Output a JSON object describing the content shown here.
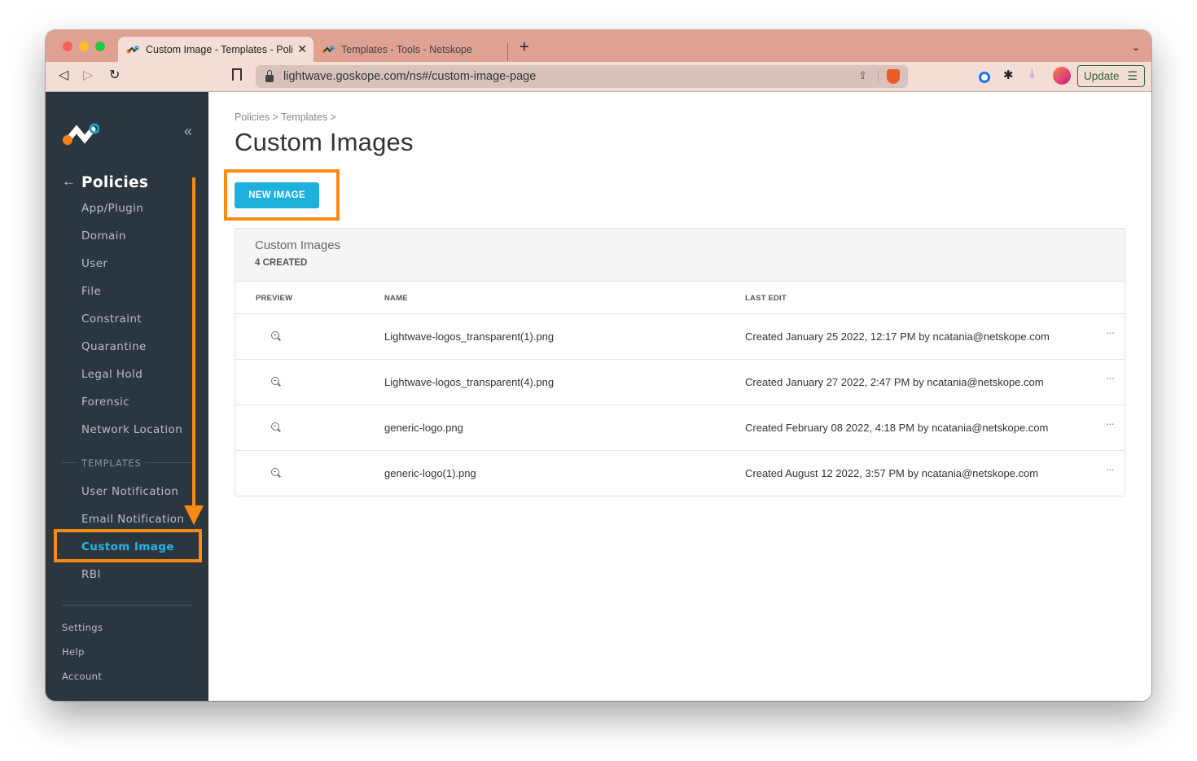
{
  "browser": {
    "tabs": [
      {
        "title": "Custom Image - Templates - Policies",
        "active": true
      },
      {
        "title": "Templates - Tools - Netskope",
        "active": false
      }
    ],
    "new_tab": "+",
    "url": "lightwave.goskope.com/ns#/custom-image-page",
    "update_label": "Update",
    "icons": {
      "back": "◁",
      "forward": "▷",
      "reload": "↻",
      "share": "⇪",
      "puzzle": "✱",
      "download": "⤓",
      "menu": "☰",
      "close": "✕",
      "chevron_down": "⌄"
    }
  },
  "sidebar": {
    "collapse_icon": "«",
    "back_icon": "←",
    "section_title": "Policies",
    "policy_items": [
      {
        "label": "App/Plugin"
      },
      {
        "label": "Domain"
      },
      {
        "label": "User"
      },
      {
        "label": "File"
      },
      {
        "label": "Constraint"
      },
      {
        "label": "Quarantine"
      },
      {
        "label": "Legal Hold"
      },
      {
        "label": "Forensic"
      },
      {
        "label": "Network Location"
      }
    ],
    "templates_label": "TEMPLATES",
    "template_items": [
      {
        "label": "User Notification",
        "active": false
      },
      {
        "label": "Email Notification",
        "active": false
      },
      {
        "label": "Custom Image",
        "active": true
      },
      {
        "label": "RBI",
        "active": false
      }
    ],
    "bottom_items": [
      {
        "label": "Settings"
      },
      {
        "label": "Help"
      },
      {
        "label": "Account"
      }
    ]
  },
  "main": {
    "breadcrumb": "Policies > Templates >",
    "title": "Custom Images",
    "new_button": "NEW IMAGE",
    "card": {
      "title": "Custom Images",
      "count": "4 CREATED",
      "columns": [
        "PREVIEW",
        "NAME",
        "LAST EDIT"
      ],
      "row_menu": "···",
      "rows": [
        {
          "name": "Lightwave-logos_transparent(1).png",
          "last_edit": "Created January 25 2022, 12:17 PM by ncatania@netskope.com"
        },
        {
          "name": "Lightwave-logos_transparent(4).png",
          "last_edit": "Created January 27 2022, 2:47 PM by ncatania@netskope.com"
        },
        {
          "name": "generic-logo.png",
          "last_edit": "Created February 08 2022, 4:18 PM by ncatania@netskope.com"
        },
        {
          "name": "generic-logo(1).png",
          "last_edit": "Created August 12 2022, 3:57 PM by ncatania@netskope.com"
        }
      ]
    }
  },
  "colors": {
    "accent": "#1fb0dc",
    "annotation": "#f98a14",
    "sidebar_bg": "#2c363f",
    "tabstrip": "#dfa191"
  }
}
